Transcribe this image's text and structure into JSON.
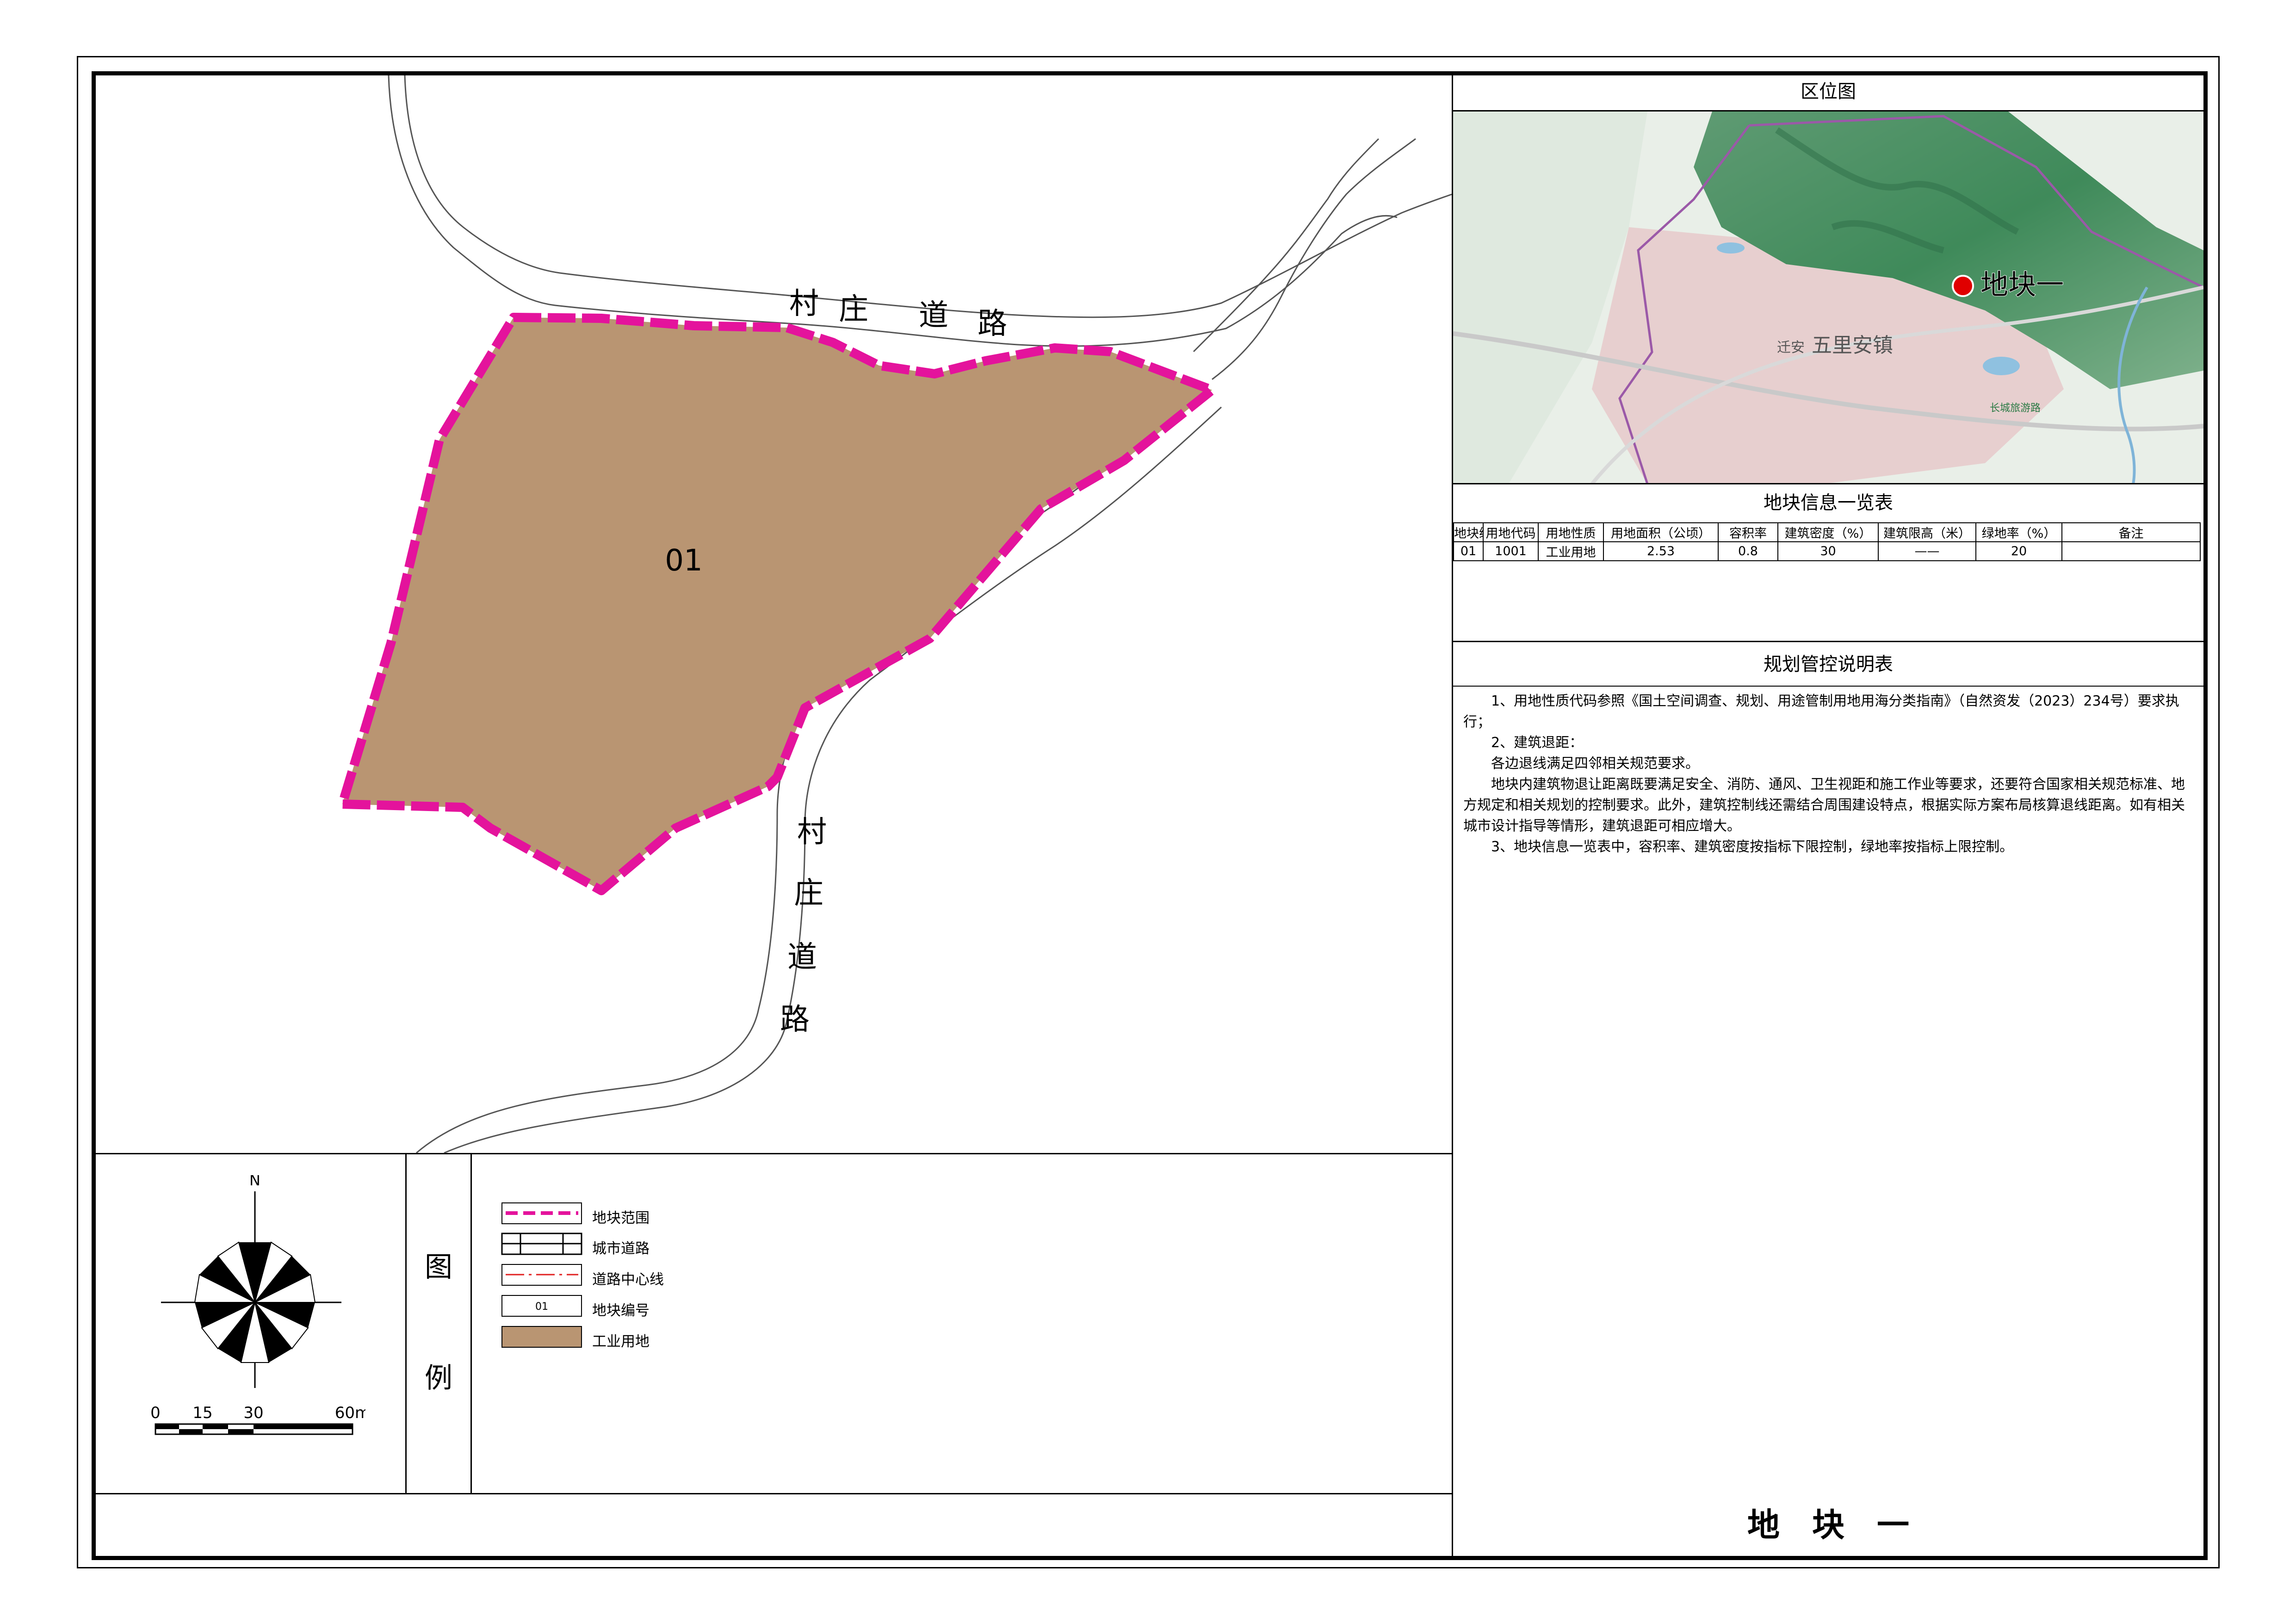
{
  "map": {
    "parcel_label": "01",
    "road_label_north": [
      "村",
      "庄",
      "道",
      "路"
    ],
    "road_label_south": [
      "村",
      "庄",
      "道",
      "路"
    ],
    "colors": {
      "parcel_fill": "#b99572",
      "parcel_boundary": "#e4139c",
      "road_line": "#555555",
      "background": "#ffffff"
    }
  },
  "north_arrow": {
    "label": "N"
  },
  "scale_bar": {
    "ticks": [
      "0",
      "15",
      "30",
      "60m"
    ]
  },
  "legend": {
    "title_chars": [
      "图",
      "例"
    ],
    "items": [
      {
        "key": "boundary",
        "label": "地块范围"
      },
      {
        "key": "road",
        "label": "城市道路"
      },
      {
        "key": "centerline",
        "label": "道路中心线"
      },
      {
        "key": "number",
        "label": "地块编号",
        "sample": "01"
      },
      {
        "key": "industrial",
        "label": "工业用地"
      }
    ]
  },
  "location_map": {
    "title": "区位图",
    "marker_label": "地块一",
    "labels": [
      "五里安镇",
      "长城旅游路",
      "迁安"
    ],
    "colors": {
      "marker": "#e00000",
      "boundary": "#9b59a8",
      "mountain": "#3f8a5a",
      "town": "#e7cfcf"
    }
  },
  "info_table": {
    "title": "地块信息一览表",
    "headers": [
      "地块编号",
      "用地代码",
      "用地性质",
      "用地面积（公顷）",
      "容积率",
      "建筑密度（%）",
      "建筑限高（米）",
      "绿地率（%）",
      "备注"
    ],
    "rows": [
      [
        "01",
        "1001",
        "工业用地",
        "2.53",
        "0.8",
        "30",
        "——",
        "20",
        ""
      ]
    ]
  },
  "control_notes": {
    "title": "规划管控说明表",
    "paragraphs": [
      "1、用地性质代码参照《国土空间调查、规划、用途管制用地用海分类指南》（自然资发（2023）234号）要求执行；",
      "2、建筑退距：",
      "各边退线满足四邻相关规范要求。",
      "地块内建筑物退让距离既要满足安全、消防、通风、卫生视距和施工作业等要求，还要符合国家相关规范标准、地方规定和相关规划的控制要求。此外，建筑控制线还需结合周围建设特点，根据实际方案布局核算退线距离。如有相关城市设计指导等情形，建筑退距可相应增大。",
      "3、地块信息一览表中，容积率、建筑密度按指标下限控制，绿地率按指标上限控制。"
    ]
  },
  "sheet_title": "地　块　一"
}
